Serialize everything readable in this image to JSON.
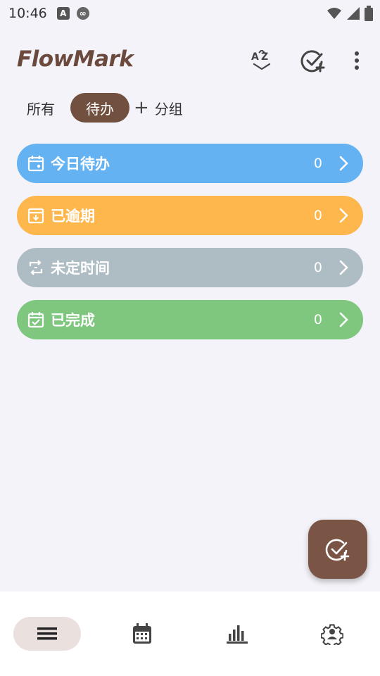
{
  "status_bar": {
    "time": "10:46",
    "notif_a": "A"
  },
  "app_bar": {
    "title": "FlowMark",
    "sort_icon": "sort-az-icon",
    "add_task_icon": "check-add-icon",
    "more_icon": "more-vert-icon"
  },
  "tabs": {
    "all_label": "所有",
    "active_label": "待办",
    "add_symbol": "+",
    "group_label": "分组"
  },
  "categories": [
    {
      "label": "今日待办",
      "count": "0",
      "color": "#64b2f2",
      "icon": "calendar-dot-icon"
    },
    {
      "label": "已逾期",
      "count": "0",
      "color": "#fdb74d",
      "icon": "overdue-icon"
    },
    {
      "label": "未定时间",
      "count": "0",
      "color": "#aebcc4",
      "icon": "repeat-arrow-icon"
    },
    {
      "label": "已完成",
      "count": "0",
      "color": "#7fc77f",
      "icon": "calendar-check-icon"
    }
  ],
  "fab": {
    "icon": "check-add-icon",
    "color": "#7a5545"
  },
  "bottom_nav": {
    "items": [
      "list-icon",
      "calendar-icon",
      "bar-chart-icon",
      "settings-icon"
    ],
    "active": "list-icon"
  },
  "colors": {
    "brand": "#6b4a3d",
    "background": "#f3f3f9",
    "tab_active": "#71503f"
  }
}
